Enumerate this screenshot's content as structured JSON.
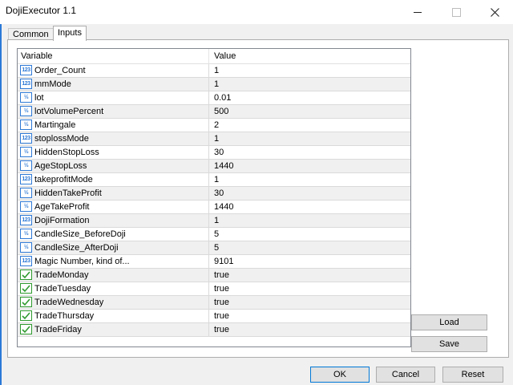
{
  "window": {
    "title": "DojiExecutor 1.1"
  },
  "tabs": [
    {
      "label": "Common"
    },
    {
      "label": "Inputs"
    }
  ],
  "grid": {
    "headers": {
      "variable": "Variable",
      "value": "Value"
    },
    "rows": [
      {
        "name": "Order_Count",
        "value": "1",
        "type_icon": "integer-icon"
      },
      {
        "name": "mmMode",
        "value": "1",
        "type_icon": "integer-icon"
      },
      {
        "name": "lot",
        "value": "0.01",
        "type_icon": "double-icon"
      },
      {
        "name": "lotVolumePercent",
        "value": "500",
        "type_icon": "double-icon"
      },
      {
        "name": "Martingale",
        "value": "2",
        "type_icon": "double-icon"
      },
      {
        "name": "stoplossMode",
        "value": "1",
        "type_icon": "integer-icon"
      },
      {
        "name": "HiddenStopLoss",
        "value": "30",
        "type_icon": "double-icon"
      },
      {
        "name": "AgeStopLoss",
        "value": "1440",
        "type_icon": "double-icon"
      },
      {
        "name": "takeprofitMode",
        "value": "1",
        "type_icon": "integer-icon"
      },
      {
        "name": "HiddenTakeProfit",
        "value": "30",
        "type_icon": "double-icon"
      },
      {
        "name": "AgeTakeProfit",
        "value": "1440",
        "type_icon": "double-icon"
      },
      {
        "name": "DojiFormation",
        "value": "1",
        "type_icon": "integer-icon"
      },
      {
        "name": "CandleSize_BeforeDoji",
        "value": "5",
        "type_icon": "double-icon"
      },
      {
        "name": "CandleSize_AfterDoji",
        "value": "5",
        "type_icon": "double-icon"
      },
      {
        "name": "Magic Number, kind of...",
        "value": "9101",
        "type_icon": "integer-icon"
      },
      {
        "name": "TradeMonday",
        "value": "true",
        "type_icon": "boolean-icon"
      },
      {
        "name": "TradeTuesday",
        "value": "true",
        "type_icon": "boolean-icon"
      },
      {
        "name": "TradeWednesday",
        "value": "true",
        "type_icon": "boolean-icon"
      },
      {
        "name": "TradeThursday",
        "value": "true",
        "type_icon": "boolean-icon"
      },
      {
        "name": "TradeFriday",
        "value": "true",
        "type_icon": "boolean-icon"
      }
    ]
  },
  "side_buttons": {
    "load": "Load",
    "save": "Save"
  },
  "footer_buttons": {
    "ok": "OK",
    "cancel": "Cancel",
    "reset": "Reset"
  },
  "colors": {
    "accent": "#0078d7",
    "integer_icon": "#2f7ad6",
    "boolean_icon": "#2f9a2f"
  }
}
